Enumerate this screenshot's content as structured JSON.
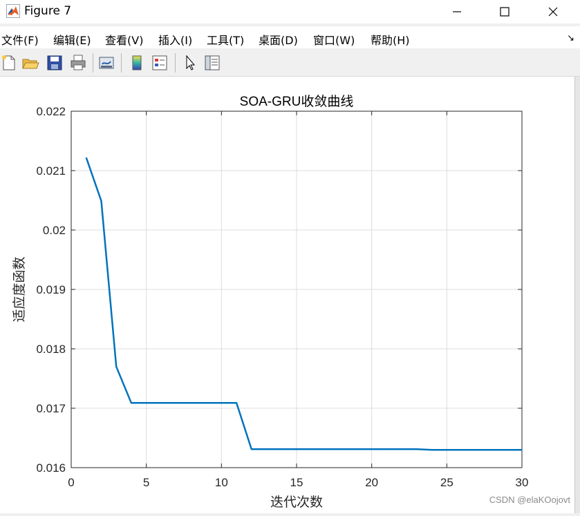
{
  "window": {
    "title": "Figure 7",
    "controls": {
      "minimize": "minimize",
      "maximize": "maximize",
      "close": "close"
    }
  },
  "menubar": {
    "items": [
      {
        "label": "文件(F)",
        "name": "menu-file"
      },
      {
        "label": "编辑(E)",
        "name": "menu-edit"
      },
      {
        "label": "查看(V)",
        "name": "menu-view"
      },
      {
        "label": "插入(I)",
        "name": "menu-insert"
      },
      {
        "label": "工具(T)",
        "name": "menu-tools"
      },
      {
        "label": "桌面(D)",
        "name": "menu-desktop"
      },
      {
        "label": "窗口(W)",
        "name": "menu-window"
      },
      {
        "label": "帮助(H)",
        "name": "menu-help"
      }
    ]
  },
  "toolbar": {
    "buttons": [
      "new-figure-icon",
      "open-folder-icon",
      "save-icon",
      "print-icon",
      "link-plot-icon",
      "colorbar-icon",
      "legend-icon",
      "pointer-icon",
      "property-inspector-icon"
    ]
  },
  "colors": {
    "line": "#0072bd",
    "grid": "#dcdcdc",
    "axis": "#262626"
  },
  "chart_data": {
    "type": "line",
    "title": "SOA-GRU收敛曲线",
    "xlabel": "迭代次数",
    "ylabel": "适应度函数",
    "xlim": [
      0,
      30
    ],
    "ylim": [
      0.016,
      0.022
    ],
    "xticks": [
      "0",
      "5",
      "10",
      "15",
      "20",
      "25",
      "30"
    ],
    "yticks": [
      "0.016",
      "0.017",
      "0.018",
      "0.019",
      "0.02",
      "0.021",
      "0.022"
    ],
    "grid": true,
    "series": [
      {
        "x": [
          1,
          2,
          3,
          4,
          5,
          6,
          7,
          8,
          9,
          10,
          11,
          12,
          13,
          14,
          15,
          16,
          17,
          18,
          19,
          20,
          21,
          22,
          23,
          24,
          25,
          26,
          27,
          28,
          29,
          30
        ],
        "values": [
          0.02122,
          0.02049,
          0.0177,
          0.01709,
          0.01709,
          0.01709,
          0.01709,
          0.01709,
          0.01709,
          0.01709,
          0.01709,
          0.01631,
          0.01631,
          0.01631,
          0.01631,
          0.01631,
          0.01631,
          0.01631,
          0.01631,
          0.01631,
          0.01631,
          0.01631,
          0.01631,
          0.0163,
          0.0163,
          0.0163,
          0.0163,
          0.0163,
          0.0163,
          0.0163
        ]
      }
    ]
  },
  "watermark": "CSDN @elaKOojovt"
}
